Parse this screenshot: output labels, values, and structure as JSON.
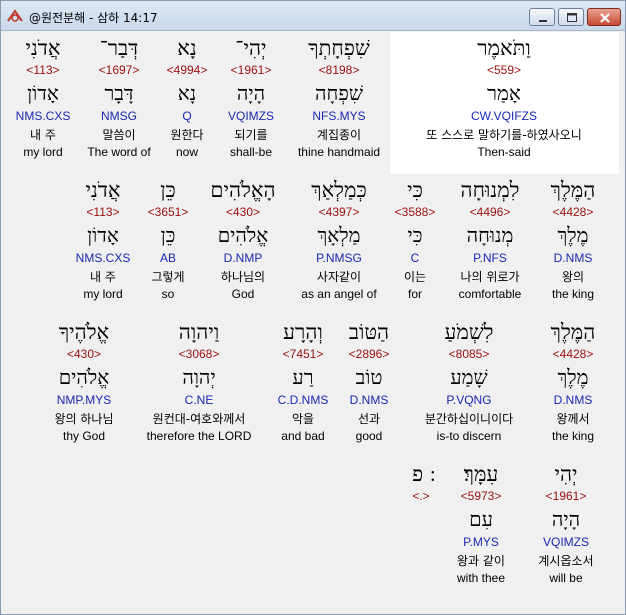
{
  "window": {
    "title": "@원전분해 - 삼하 14:17"
  },
  "rows": [
    {
      "words": [
        {
          "heb": "אֲדֹנִי",
          "strong": "<113>",
          "lemma": "אָדוֹן",
          "morph": "NMS.CXS",
          "kor": "내 주",
          "eng": "my lord"
        },
        {
          "heb": "דְּבַר־",
          "strong": "<1697>",
          "lemma": "דָּבָר",
          "morph": "NMSG",
          "kor": "말씀이",
          "eng": "The word of"
        },
        {
          "heb": "נָא",
          "strong": "<4994>",
          "lemma": "נָא",
          "morph": "Q",
          "kor": "원한다",
          "eng": "now"
        },
        {
          "heb": "יְהִי־",
          "strong": "<1961>",
          "lemma": "הָיָה",
          "morph": "VQIMZS",
          "kor": "되기를",
          "eng": "shall-be"
        },
        {
          "heb": "שִׁפְחָתְךָ",
          "strong": "<8198>",
          "lemma": "שִׁפְחָה",
          "morph": "NFS.MYS",
          "kor": "계집종이",
          "eng": "thine handmaid"
        },
        {
          "heb": "וַתֹּאמֶר",
          "strong": "<559>",
          "lemma": "אָמַר",
          "morph": "CW.VQIFZS",
          "kor": "또 스스로 말하기를-하였사오니",
          "eng": "Then-said"
        }
      ]
    },
    {
      "words": [
        {
          "heb": "אֲדֹנִי",
          "strong": "<113>",
          "lemma": "אָדוֹן",
          "morph": "NMS.CXS",
          "kor": "내 주",
          "eng": "my lord"
        },
        {
          "heb": "כֵּן",
          "strong": "<3651>",
          "lemma": "כֵּן",
          "morph": "AB",
          "kor": "그렇게",
          "eng": "so"
        },
        {
          "heb": "הָאֱלֹהִים",
          "strong": "<430>",
          "lemma": "אֱלֹהִים",
          "morph": "D.NMP",
          "kor": "하나님의",
          "eng": "God"
        },
        {
          "heb": "כְּמַלְאַךְ",
          "strong": "<4397>",
          "lemma": "מַלְאָךְ",
          "morph": "P.NMSG",
          "kor": "사자같이",
          "eng": "as an angel of"
        },
        {
          "heb": "כִּי",
          "strong": "<3588>",
          "lemma": "כִּי",
          "morph": "C",
          "kor": "이는",
          "eng": "for"
        },
        {
          "heb": "לִמְנוּחָה",
          "strong": "<4496>",
          "lemma": "מְנוּחָה",
          "morph": "P.NFS",
          "kor": "나의 위로가",
          "eng": "comfortable"
        },
        {
          "heb": "הַמֶּלֶךְ",
          "strong": "<4428>",
          "lemma": "מֶלֶךְ",
          "morph": "D.NMS",
          "kor": "왕의",
          "eng": "the king"
        }
      ]
    },
    {
      "words": [
        {
          "heb": "אֱלֹהֶיךָ",
          "strong": "<430>",
          "lemma": "אֱלֹהִים",
          "morph": "NMP.MYS",
          "kor": "왕의 하나님",
          "eng": "thy God"
        },
        {
          "heb": "וַיהוָה",
          "strong": "<3068>",
          "lemma": "יְהוָה",
          "morph": "C.NE",
          "kor": "원컨대-여호와께서",
          "eng": "therefore the LORD"
        },
        {
          "heb": "וְהָרָע",
          "strong": "<7451>",
          "lemma": "רַע",
          "morph": "C.D.NMS",
          "kor": "악을",
          "eng": "and bad"
        },
        {
          "heb": "הַטּוֹב",
          "strong": "<2896>",
          "lemma": "טוֹב",
          "morph": "D.NMS",
          "kor": "선과",
          "eng": "good"
        },
        {
          "heb": "לִשְׁמֹעַ",
          "strong": "<8085>",
          "lemma": "שָׁמַע",
          "morph": "P.VQNG",
          "kor": "분간하십이니이다",
          "eng": "is-to discern"
        },
        {
          "heb": "הַמֶּלֶךְ",
          "strong": "<4428>",
          "lemma": "מֶלֶךְ",
          "morph": "D.NMS",
          "kor": "왕께서",
          "eng": "the king"
        }
      ]
    },
    {
      "words": [
        {
          "heb": "׃ פ",
          "strong": "<.>",
          "lemma": "",
          "morph": "",
          "kor": "",
          "eng": ""
        },
        {
          "heb": "עִמָּךְ׃",
          "strong": "<5973>",
          "lemma": "עִם",
          "morph": "P.MYS",
          "kor": "왕과 같이",
          "eng": "with thee"
        },
        {
          "heb": "יְהִי",
          "strong": "<1961>",
          "lemma": "הָיָה",
          "morph": "VQIMZS",
          "kor": "계시옵소서",
          "eng": "will be"
        }
      ]
    }
  ]
}
